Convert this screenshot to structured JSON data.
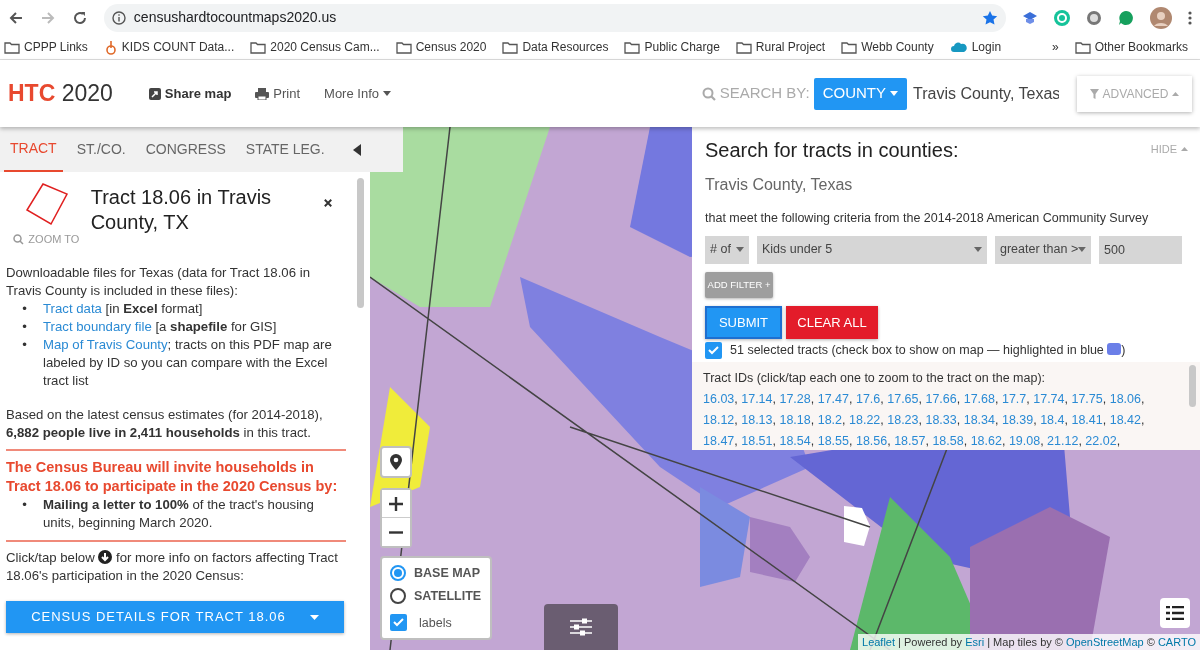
{
  "browser": {
    "url": "censushardtocountmaps2020.us",
    "bookmarks": [
      {
        "label": "CPPP Links",
        "kind": "folder"
      },
      {
        "label": "KIDS COUNT Data...",
        "kind": "site"
      },
      {
        "label": "2020 Census Cam...",
        "kind": "folder"
      },
      {
        "label": "Census 2020",
        "kind": "folder"
      },
      {
        "label": "Data Resources",
        "kind": "folder"
      },
      {
        "label": "Public Charge",
        "kind": "folder"
      },
      {
        "label": "Rural Project",
        "kind": "folder"
      },
      {
        "label": "Webb County",
        "kind": "folder"
      },
      {
        "label": "Login",
        "kind": "cloud"
      }
    ],
    "overflow": "»",
    "other": "Other Bookmarks"
  },
  "header": {
    "brand": "HTC",
    "year": "2020",
    "nav": [
      {
        "label": "Share map",
        "kind": "share"
      },
      {
        "label": "Print",
        "kind": "print"
      },
      {
        "label": "More Info",
        "kind": "menu"
      }
    ],
    "search_label": "SEARCH BY:",
    "search_by": "COUNTY",
    "search_value": "Travis County, Texas",
    "advanced": "ADVANCED"
  },
  "tabs": [
    {
      "label": "TRACT",
      "selected": true
    },
    {
      "label": "ST./CO.",
      "selected": false
    },
    {
      "label": "CONGRESS",
      "selected": false
    },
    {
      "label": "STATE LEG.",
      "selected": false
    }
  ],
  "tract": {
    "bullet": "•",
    "title": "Tract 18.06 in Travis County, TX",
    "zoom_label": "ZOOM TO",
    "intro": "Downloadable files for Texas (data for Tract 18.06 in Travis County is included in these files):",
    "files": [
      {
        "link": "Tract data",
        "rest": " [in **Excel** format]"
      },
      {
        "link": "Tract boundary file",
        "rest": " [a **shapefile** for GIS]"
      },
      {
        "link": "Map of Travis County",
        "rest": "; tracts on this PDF map are labeled by ID so you can compare with the Excel tract list"
      }
    ],
    "estimate": "Based on the latest census estimates (for 2014-2018), **6,882 people live in 2,411 households** in this tract.",
    "notice": "The Census Bureau will invite households in Tract 18.06 to participate in the 2020 Census by:",
    "notice_items": [
      "**Mailing a letter to 100%** of the tract's housing units, beginning March 2020."
    ],
    "click_before": "Click/tap below",
    "click_after": "for more info on factors affecting Tract 18.06's participation in the 2020 Census:",
    "details_button": "CENSUS DETAILS FOR TRACT 18.06"
  },
  "search_panel": {
    "title": "Search for tracts in counties:",
    "hide": "HIDE",
    "county": "Travis County, Texas",
    "criteria": "that meet the following criteria from the 2014-2018 American Community Survey",
    "filter": {
      "measure": "# of",
      "variable": "Kids under 5",
      "operator": "greater than >",
      "value": "500"
    },
    "add_filter": "ADD FILTER +",
    "submit": "SUBMIT",
    "clear": "CLEAR ALL",
    "show_selected": {
      "checked": true,
      "label_before": "51 selected tracts (check box to show on map — highlighted in blue",
      "label_after": ")",
      "color": "#6b7fe8"
    },
    "ids_label": "Tract IDs (click/tap each one to zoom to the tract on the map):",
    "id_separator": ", ",
    "ids": [
      "16.03",
      "17.14",
      "17.28",
      "17.47",
      "17.6",
      "17.65",
      "17.66",
      "17.68",
      "17.7",
      "17.74",
      "17.75",
      "18.06",
      "18.12",
      "18.13",
      "18.18",
      "18.2",
      "18.22",
      "18.23",
      "18.33",
      "18.34",
      "18.39",
      "18.4",
      "18.41",
      "18.42",
      "18.47",
      "18.51",
      "18.54",
      "18.55",
      "18.56",
      "18.57",
      "18.58",
      "18.62",
      "19.08",
      "21.12",
      "22.02"
    ],
    "trailing": ","
  },
  "map": {
    "layers": [
      {
        "label": "BASE MAP",
        "selected": true
      },
      {
        "label": "SATELLITE",
        "selected": false
      }
    ],
    "labels": {
      "label": "labels",
      "checked": true
    },
    "attribution": [
      {
        "text": "Leaflet",
        "kind": "link"
      },
      {
        "text": " | Powered by ",
        "kind": "text"
      },
      {
        "text": "Esri",
        "kind": "link"
      },
      {
        "text": " | Map tiles by © ",
        "kind": "text"
      },
      {
        "text": "OpenStreetMap",
        "kind": "link"
      },
      {
        "text": " © ",
        "kind": "text"
      },
      {
        "text": "CARTO",
        "kind": "link"
      }
    ]
  }
}
